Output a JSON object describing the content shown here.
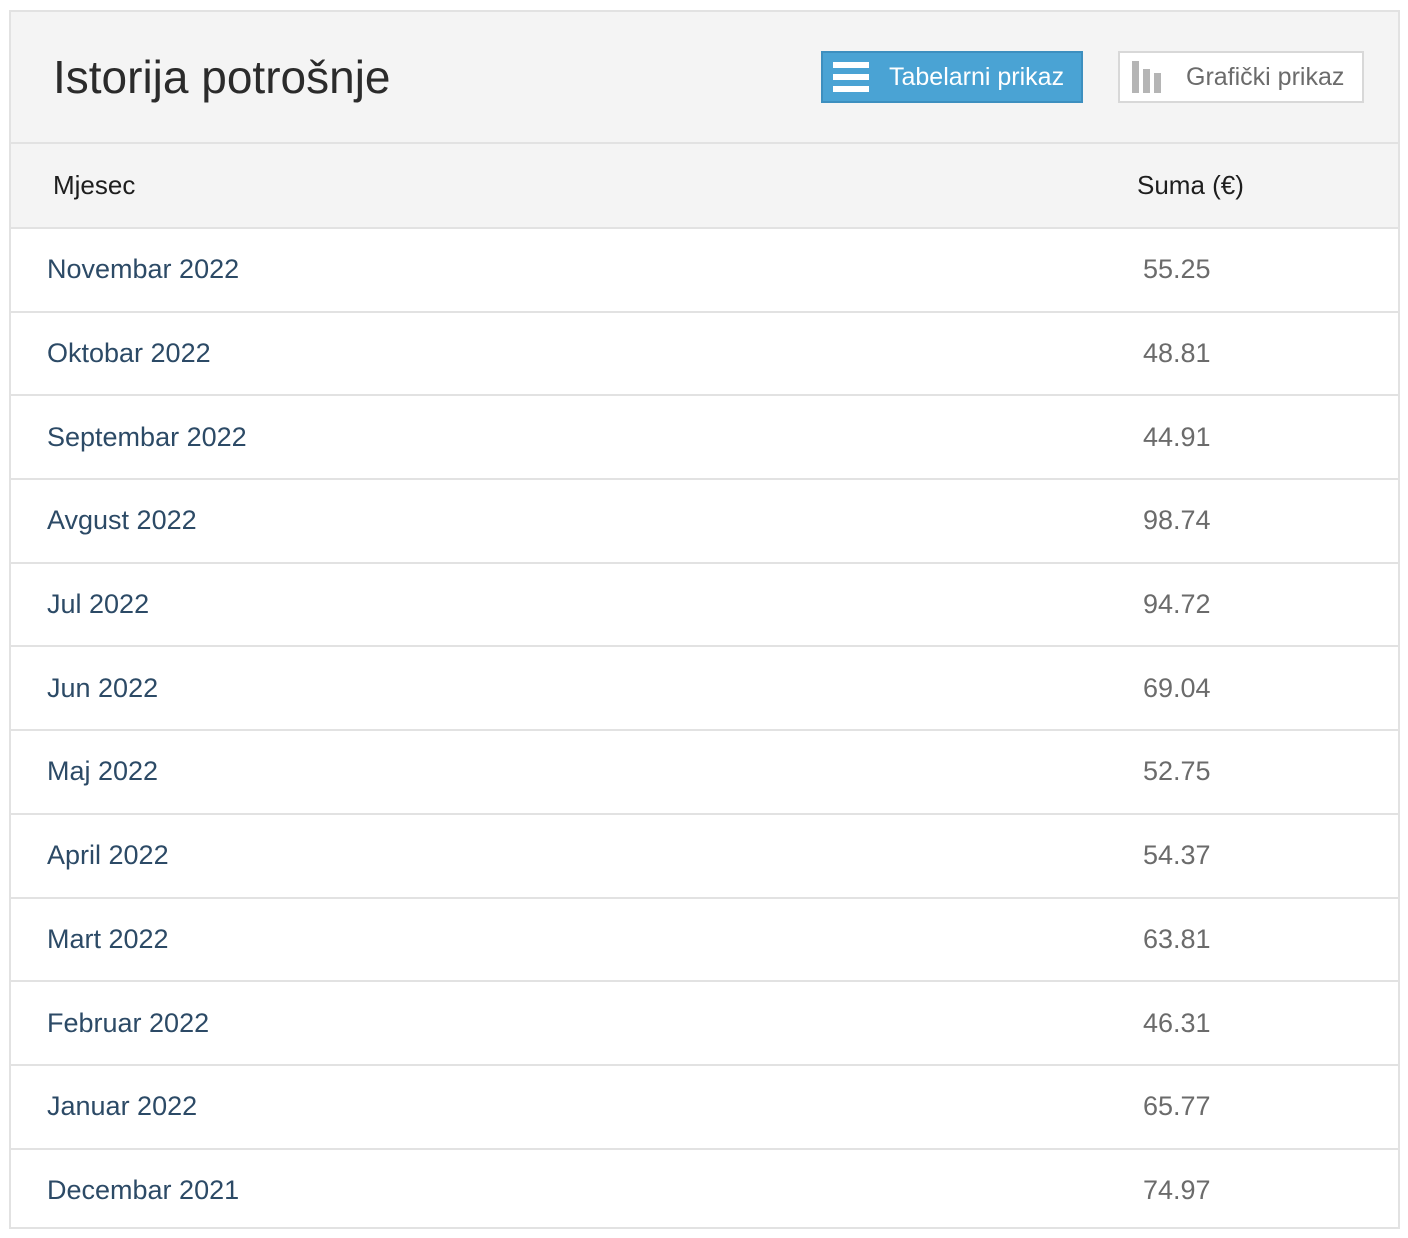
{
  "header": {
    "title": "Istorija potrošnje",
    "table_view_label": "Tabelarni prikaz",
    "chart_view_label": "Grafički prikaz",
    "table_view_icon": "list-icon",
    "chart_view_icon": "bar-chart-icon",
    "active_view": "table"
  },
  "table": {
    "columns": [
      "Mjesec",
      "Suma (€)"
    ],
    "rows": [
      {
        "month": "Novembar 2022",
        "sum": "55.25"
      },
      {
        "month": "Oktobar 2022",
        "sum": "48.81"
      },
      {
        "month": "Septembar 2022",
        "sum": "44.91"
      },
      {
        "month": "Avgust 2022",
        "sum": "98.74"
      },
      {
        "month": "Jul 2022",
        "sum": "94.72"
      },
      {
        "month": "Jun 2022",
        "sum": "69.04"
      },
      {
        "month": "Maj 2022",
        "sum": "52.75"
      },
      {
        "month": "April 2022",
        "sum": "54.37"
      },
      {
        "month": "Mart 2022",
        "sum": "63.81"
      },
      {
        "month": "Februar 2022",
        "sum": "46.31"
      },
      {
        "month": "Januar 2022",
        "sum": "65.77"
      },
      {
        "month": "Decembar 2021",
        "sum": "74.97"
      }
    ]
  },
  "colors": {
    "accent": "#4aa3d4",
    "month_text": "#2c4a66",
    "sum_text": "#6b6b6b",
    "header_bg": "#f4f4f4",
    "border": "#e2e2e2"
  }
}
